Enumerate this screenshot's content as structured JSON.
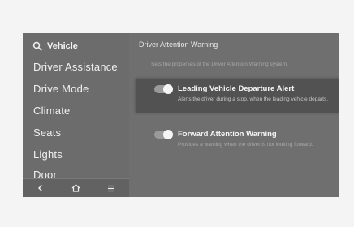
{
  "sidebar": {
    "header": "Vehicle",
    "items": [
      {
        "label": "Driver Assistance"
      },
      {
        "label": "Drive Mode"
      },
      {
        "label": "Climate"
      },
      {
        "label": "Seats"
      },
      {
        "label": "Lights"
      },
      {
        "label": "Door"
      }
    ],
    "nav": {
      "back_icon": "chevron-left-icon",
      "home_icon": "home-icon",
      "menu_icon": "hamburger-icon"
    }
  },
  "content": {
    "title": "Driver Attention Warning",
    "description": "Sets the properties of the Driver Attention Warning system.",
    "options": [
      {
        "title": "Leading Vehicle Departure Alert",
        "description": "Alerts the driver during a stop, when the leading vehicle departs.",
        "enabled": true
      },
      {
        "title": "Forward Attention Warning",
        "description": "Provides a warning when the driver is not looking forward.",
        "enabled": true
      }
    ]
  },
  "colors": {
    "screen_bg": "#6f6f6f",
    "selected_bg": "#525252",
    "text": "#f0f0f0"
  }
}
